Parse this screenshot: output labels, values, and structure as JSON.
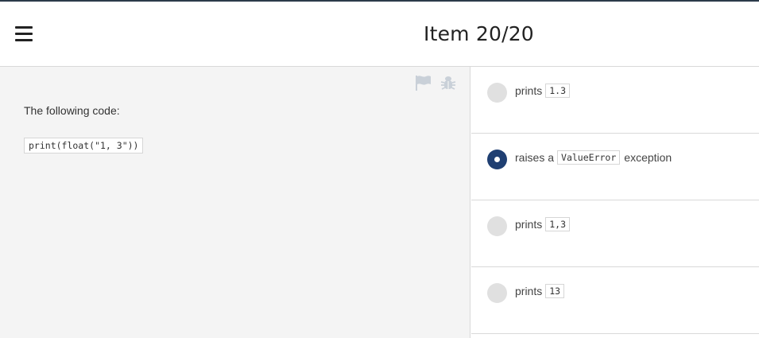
{
  "header": {
    "title": "Item 20/20",
    "menu_icon": "hamburger-menu-icon"
  },
  "question": {
    "prompt": "The following code:",
    "code": "print(float(\"1, 3\"))",
    "tools": [
      "flag-icon",
      "bug-report-icon"
    ]
  },
  "options": [
    {
      "before": "prints",
      "code": "1.3",
      "after": "",
      "selected": false
    },
    {
      "before": "raises a",
      "code": "ValueError",
      "after": "exception",
      "selected": true
    },
    {
      "before": "prints",
      "code": "1,3",
      "after": "",
      "selected": false
    },
    {
      "before": "prints",
      "code": "13",
      "after": "",
      "selected": false
    }
  ],
  "colors": {
    "selected_radio": "#1f3f72",
    "unselected_radio": "#e0e0e0",
    "question_bg": "#f4f4f4"
  }
}
